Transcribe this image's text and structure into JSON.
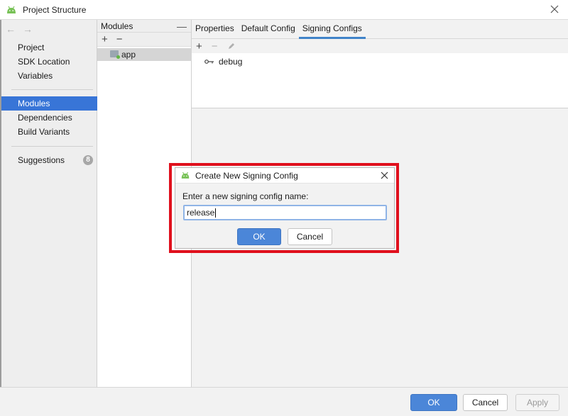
{
  "window": {
    "title": "Project Structure",
    "icon": "android-icon"
  },
  "sidebar": {
    "items": [
      {
        "label": "Project"
      },
      {
        "label": "SDK Location"
      },
      {
        "label": "Variables"
      },
      {
        "label": "Modules",
        "selected": true
      },
      {
        "label": "Dependencies"
      },
      {
        "label": "Build Variants"
      },
      {
        "label": "Suggestions",
        "badge": "8"
      }
    ]
  },
  "modules": {
    "header": "Modules",
    "add": "+",
    "remove": "−",
    "collapse": "—",
    "items": [
      {
        "label": "app"
      }
    ]
  },
  "tabs": [
    {
      "label": "Properties"
    },
    {
      "label": "Default Config"
    },
    {
      "label": "Signing Configs",
      "active": true
    }
  ],
  "signing": {
    "add": "+",
    "remove": "−",
    "entries": [
      {
        "label": "debug"
      }
    ]
  },
  "dialog": {
    "title": "Create New Signing Config",
    "prompt": "Enter a new signing config name:",
    "value": "release",
    "ok": "OK",
    "cancel": "Cancel"
  },
  "footer": {
    "ok": "OK",
    "cancel": "Cancel",
    "apply": "Apply"
  },
  "colors": {
    "accent": "#3875d7",
    "highlight": "#e0101d",
    "android": "#78c257"
  }
}
